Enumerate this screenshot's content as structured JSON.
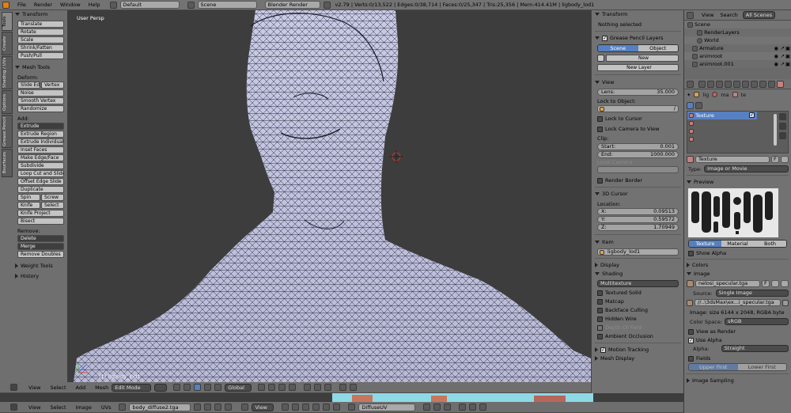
{
  "topbar": {
    "menus": [
      "File",
      "Render",
      "Window",
      "Help"
    ],
    "layout": "Default",
    "scene": "Scene",
    "engine": "Blender Render",
    "stats": "v2.79 | Verts:0/13,522 | Edges:0/38,714 | Faces:0/25,347 | Tris:25,356 | Mem:414.41M | ligbody_lod1"
  },
  "toolshelf": {
    "tabs": [
      "Tools",
      "Create",
      "Shading / UVs",
      "Options",
      "Grease Pencil",
      "Bsurfaces"
    ],
    "transform": {
      "title": "Transform",
      "buttons": [
        "Translate",
        "Rotate",
        "Scale",
        "Shrink/Fatten",
        "Push/Pull"
      ]
    },
    "meshtools": {
      "title": "Mesh Tools",
      "deform": "Deform:",
      "slide_edge": "Slide Ed",
      "vertex": "Vertex",
      "noise": "Noise",
      "smooth": "Smooth Vertex",
      "randomize": "Randomize",
      "add": "Add:",
      "extrude": "Extrude",
      "extrude_region": "Extrude Region",
      "extrude_individual": "Extrude Individual",
      "inset": "Inset Faces",
      "make_edge": "Make Edge/Face",
      "subdivide": "Subdivide",
      "loopcut": "Loop Cut and Slide",
      "offset_edge": "Offset Edge Slide",
      "duplicate": "Duplicate",
      "spin": "Spin",
      "screw": "Screw",
      "knife": "Knife",
      "select": "Select",
      "knife_project": "Knife Project",
      "bisect": "Bisect",
      "remove": "Remove:",
      "delete": "Delete",
      "merge": "Merge",
      "remove_doubles": "Remove Doubles"
    },
    "weight_tools": "Weight Tools",
    "history": "History"
  },
  "viewport": {
    "label": "User Persp",
    "object": "(1) ligbody_lod1"
  },
  "viewport_header": {
    "items": [
      "View",
      "Select",
      "Add",
      "Mesh"
    ],
    "mode": "Edit Mode",
    "orientation": "Global"
  },
  "npanel": {
    "transform": "Transform",
    "nothing": "Nothing selected",
    "gp_layers": "Grease Pencil Layers",
    "scene_tab": "Scene",
    "object_tab": "Object",
    "new": "New",
    "new_layer": "New Layer",
    "view": "View",
    "lens_label": "Lens:",
    "lens": "35.000",
    "lock_to_object": "Lock to Object:",
    "lock_cursor": "Lock to Cursor",
    "lock_camera": "Lock Camera to View",
    "clip": "Clip:",
    "start_label": "Start:",
    "start": "0.001",
    "end_label": "End:",
    "end": "1000.000",
    "local_camera": "Local Camera",
    "render_border": "Render Border",
    "cursor": "3D Cursor",
    "location": "Location:",
    "x_label": "X:",
    "x": "0.09513",
    "y_label": "Y:",
    "y": "0.59572",
    "z_label": "Z:",
    "z": "1.70949",
    "item": "Item",
    "item_name": "ligbody_lod1",
    "display": "Display",
    "shading": "Shading",
    "shading_mode": "Multitexture",
    "textured_solid": "Textured Solid",
    "matcap": "Matcap",
    "backface": "Backface Culling",
    "hidden_wire": "Hidden Wire",
    "depth_field": "Depth Of Field",
    "ambient": "Ambient Occlusion",
    "motion": "Motion Tracking",
    "mesh_display": "Mesh Display"
  },
  "outliner": {
    "menus": [
      "View",
      "Search",
      "All Scenes"
    ],
    "items": [
      "Scene",
      "RenderLayers",
      "World",
      "Armature",
      "animroot",
      "animroot.001"
    ]
  },
  "properties": {
    "context": [
      "lig",
      "ma",
      "te"
    ],
    "tex_slot": "Texture",
    "tex_name": "Texture",
    "f_label": "F",
    "type_label": "Type:",
    "type": "Image or Movie",
    "preview": "Preview",
    "tabs": [
      "Texture",
      "Material",
      "Both"
    ],
    "show_alpha": "Show Alpha",
    "colors": "Colors",
    "image": "Image",
    "image_name": "nelosi_specular.tga",
    "source_label": "Source:",
    "source": "Single Image",
    "path": "//..\\3dsMax\\ex...i_specular.tga",
    "image_info": "Image: size 6144 x 2048, RGBA byte",
    "colorspace_label": "Color Space:",
    "colorspace": "sRGB",
    "view_as_render": "View as Render",
    "use_alpha": "Use Alpha",
    "alpha_label": "Alpha:",
    "alpha": "Straight",
    "fields": "Fields",
    "upper_first": "Upper First",
    "lower_first": "Lower First",
    "image_sampling": "Image Sampling"
  },
  "uv_header": {
    "items": [
      "View",
      "Select",
      "Image",
      "UVs"
    ],
    "image": "body_diffuse2.tga",
    "view": "View",
    "uvmap": "DiffuseUV"
  }
}
